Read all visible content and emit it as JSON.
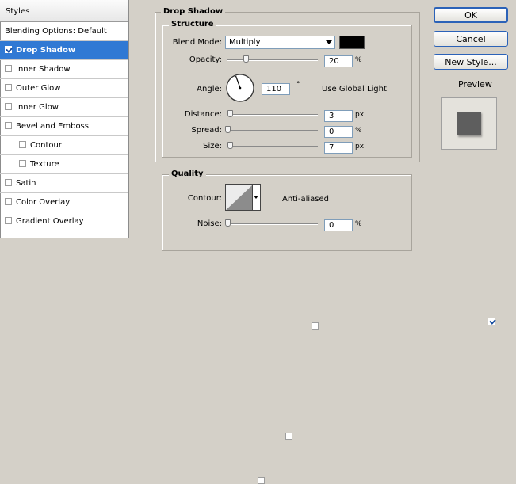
{
  "styles_panel": {
    "header": "Styles",
    "items": [
      {
        "label": "Blending Options: Default",
        "checkbox": false,
        "checked": false,
        "selected": false,
        "sub": false
      },
      {
        "label": "Drop Shadow",
        "checkbox": true,
        "checked": true,
        "selected": true,
        "sub": false
      },
      {
        "label": "Inner Shadow",
        "checkbox": true,
        "checked": false,
        "selected": false,
        "sub": false
      },
      {
        "label": "Outer Glow",
        "checkbox": true,
        "checked": false,
        "selected": false,
        "sub": false
      },
      {
        "label": "Inner Glow",
        "checkbox": true,
        "checked": false,
        "selected": false,
        "sub": false
      },
      {
        "label": "Bevel and Emboss",
        "checkbox": true,
        "checked": false,
        "selected": false,
        "sub": false
      },
      {
        "label": "Contour",
        "checkbox": true,
        "checked": false,
        "selected": false,
        "sub": true
      },
      {
        "label": "Texture",
        "checkbox": true,
        "checked": false,
        "selected": false,
        "sub": true
      },
      {
        "label": "Satin",
        "checkbox": true,
        "checked": false,
        "selected": false,
        "sub": false
      },
      {
        "label": "Color Overlay",
        "checkbox": true,
        "checked": false,
        "selected": false,
        "sub": false
      },
      {
        "label": "Gradient Overlay",
        "checkbox": true,
        "checked": false,
        "selected": false,
        "sub": false
      }
    ]
  },
  "drop_shadow": {
    "title": "Drop Shadow",
    "structure_title": "Structure",
    "blend_mode_label": "Blend Mode:",
    "blend_mode_value": "Multiply",
    "shadow_color": "#000000",
    "opacity_label": "Opacity:",
    "opacity_value": "20",
    "opacity_unit": "%",
    "opacity_level": 0.2,
    "angle_label": "Angle:",
    "angle_value": "110",
    "angle_unit": "°",
    "angle_degrees": 110,
    "global_light_label": "Use Global Light",
    "global_light_checked": false,
    "distance_label": "Distance:",
    "distance_value": "3",
    "distance_unit": "px",
    "distance_level": 0.03,
    "spread_label": "Spread:",
    "spread_value": "0",
    "spread_unit": "%",
    "spread_level": 0.0,
    "size_label": "Size:",
    "size_value": "7",
    "size_unit": "px",
    "size_level": 0.03
  },
  "quality": {
    "title": "Quality",
    "contour_label": "Contour:",
    "anti_aliased_label": "Anti-aliased",
    "anti_aliased_checked": false,
    "noise_label": "Noise:",
    "noise_value": "0",
    "noise_unit": "%",
    "noise_level": 0.0
  },
  "buttons": {
    "ok": "OK",
    "cancel": "Cancel",
    "new_style": "New Style...",
    "preview_label": "Preview",
    "preview_checked": true
  },
  "colors": {
    "accent": "#3079d4",
    "dialog_bg": "#d4d0c8",
    "preview_swatch": "#5e5e5e"
  }
}
